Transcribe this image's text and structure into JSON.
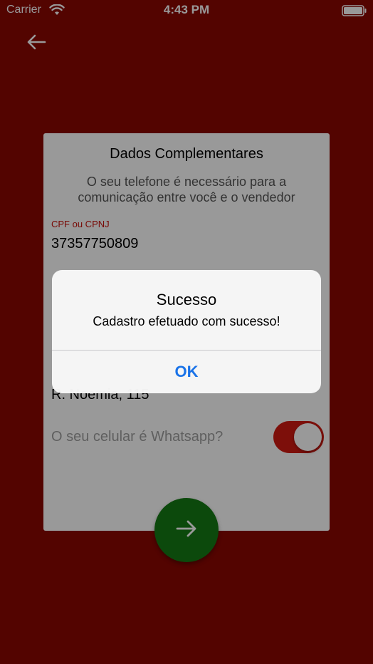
{
  "status_bar": {
    "carrier": "Carrier",
    "time": "4:43 PM"
  },
  "form": {
    "title": "Dados Complementares",
    "subtitle": "O seu telefone é necessário para a comunicação entre você e o vendedor",
    "cpf_label": "CPF ou CPNJ",
    "cpf_value": "37357750809",
    "address_value": "R. Noemia, 115",
    "whatsapp_label": "O seu celular é Whatsapp?",
    "whatsapp_enabled": true
  },
  "alert": {
    "title": "Sucesso",
    "message": "Cadastro efetuado com sucesso!",
    "ok_label": "OK"
  },
  "colors": {
    "background": "#8a0700",
    "accent_red": "#d11a12",
    "fab_green": "#157a15",
    "ios_blue": "#1a73e8"
  },
  "icons": {
    "back": "arrow-left-icon",
    "next": "arrow-right-icon",
    "wifi": "wifi-icon",
    "battery": "battery-icon"
  }
}
